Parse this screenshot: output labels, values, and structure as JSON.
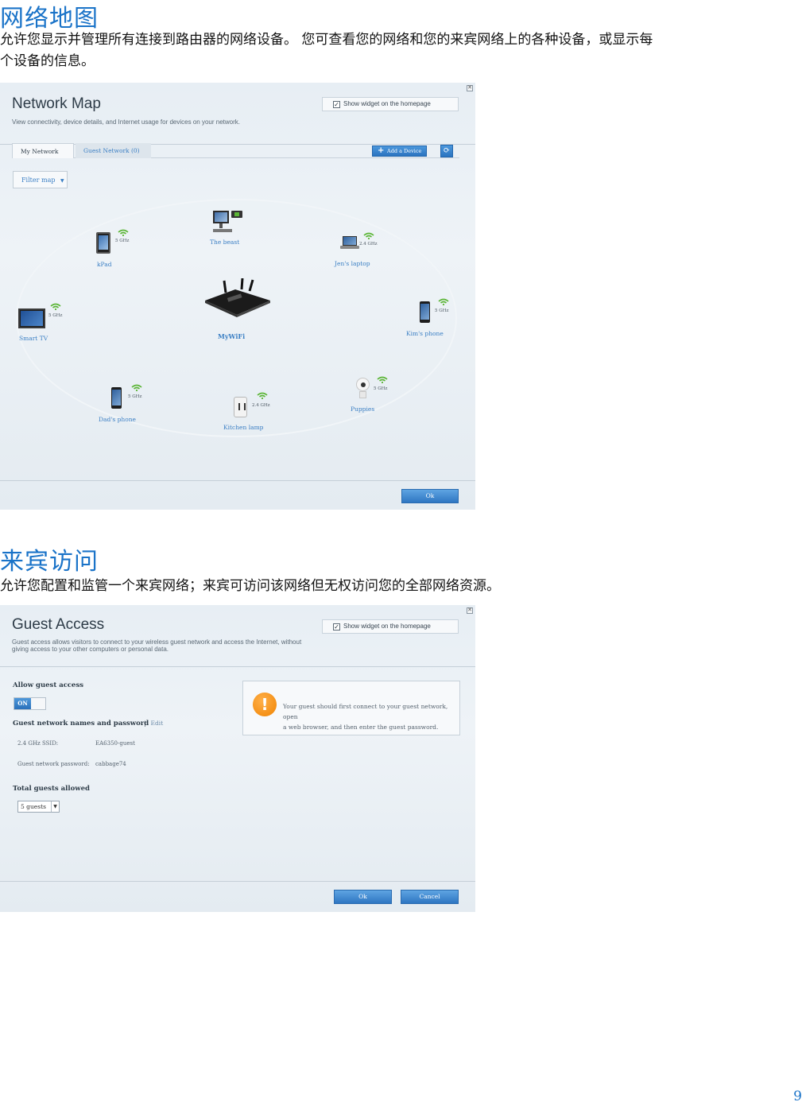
{
  "section1": {
    "title": "网络地图",
    "desc_line1": "允许您显示并管理所有连接到路由器的网络设备。 您可查看您的网络和您的来宾网络上的各种设备，或显示每",
    "desc_line2": "个设备的信息。"
  },
  "network_map": {
    "title": "Network Map",
    "subtitle": "View connectivity, device details, and Internet usage for devices on your network.",
    "widget_label": "Show widget on the homepage",
    "widget_checked": true,
    "tabs": [
      {
        "label": "My Network",
        "active": true
      },
      {
        "label": "Guest Network (0)",
        "active": false
      }
    ],
    "add_device_label": "Add a Device",
    "filter_label": "Filter map",
    "router_name": "MyWiFi",
    "devices": [
      {
        "name": "kPad",
        "band": "5 GHz",
        "icon": "tablet-icon"
      },
      {
        "name": "The beast",
        "band": "",
        "icon": "desktop-icon"
      },
      {
        "name": "Jen's laptop",
        "band": "2.4 GHz",
        "icon": "laptop-icon"
      },
      {
        "name": "Smart TV",
        "band": "5 GHz",
        "icon": "tv-icon"
      },
      {
        "name": "Kim's phone",
        "band": "5 GHz",
        "icon": "phone-icon"
      },
      {
        "name": "Dad's phone",
        "band": "5 GHz",
        "icon": "phone-icon"
      },
      {
        "name": "Kitchen lamp",
        "band": "2.4 GHz",
        "icon": "smart-plug-icon"
      },
      {
        "name": "Puppies",
        "band": "5 GHz",
        "icon": "camera-icon"
      }
    ],
    "ok_label": "Ok"
  },
  "section2": {
    "title": "来宾访问",
    "desc": "允许您配置和监管一个来宾网络；来宾可访问该网络但无权访问您的全部网络资源。"
  },
  "guest_access": {
    "title": "Guest Access",
    "subtitle_line1": "Guest access allows visitors to connect to your wireless guest network and access the Internet, without",
    "subtitle_line2": "giving access to your other computers or personal data.",
    "widget_label": "Show widget on the homepage",
    "widget_checked": true,
    "allow_label": "Allow guest access",
    "toggle_state": "ON",
    "names_label": "Guest network names and password",
    "edit_label": "Edit",
    "ssid_label": "2.4 GHz SSID:",
    "ssid_value": "EA6350-guest",
    "password_label": "Guest network password:",
    "password_value": "cabbage74",
    "total_label": "Total guests allowed",
    "guests_selected": "5 guests",
    "warning_line1": "Your guest should first connect to your guest network, open",
    "warning_line2": "a web browser, and then enter the guest password.",
    "ok_label": "Ok",
    "cancel_label": "Cancel"
  },
  "page_number": "9",
  "colors": {
    "accent": "#1a73c8",
    "link": "#3b7fc4",
    "wifi_green": "#5bb536",
    "warning_orange": "#f08300"
  }
}
